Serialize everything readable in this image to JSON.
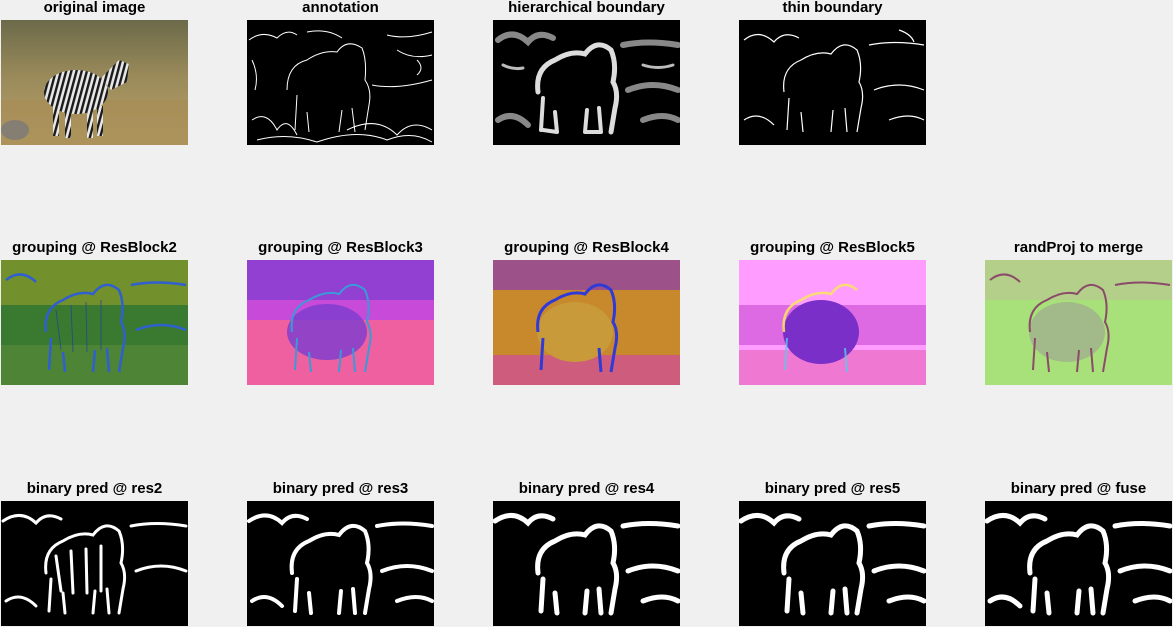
{
  "figure": {
    "rows": [
      {
        "panels": [
          {
            "title": "original image",
            "kind": "photo"
          },
          {
            "title": "annotation",
            "kind": "annotation"
          },
          {
            "title": "hierarchical boundary",
            "kind": "soft-boundary"
          },
          {
            "title": "thin boundary",
            "kind": "thin-boundary"
          }
        ]
      },
      {
        "panels": [
          {
            "title": "grouping @ ResBlock2",
            "kind": "grouping",
            "colors": [
              "#3a8a35",
              "#2f5fd0",
              "#9aa428"
            ]
          },
          {
            "title": "grouping @ ResBlock3",
            "kind": "grouping",
            "colors": [
              "#8a3cd6",
              "#ff6a8a",
              "#d24ad8"
            ]
          },
          {
            "title": "grouping @ ResBlock4",
            "kind": "grouping",
            "colors": [
              "#c88a2c",
              "#9a3ab0",
              "#2f4ad8"
            ]
          },
          {
            "title": "grouping @ ResBlock5",
            "kind": "grouping",
            "colors": [
              "#ff8cff",
              "#7a2fc8",
              "#e84ab0"
            ]
          },
          {
            "title": "randProj to merge",
            "kind": "grouping",
            "colors": [
              "#a8e07a",
              "#b08ab0",
              "#8c5a7a"
            ]
          }
        ]
      },
      {
        "panels": [
          {
            "title": "binary pred @ res2",
            "kind": "binary"
          },
          {
            "title": "binary pred @ res3",
            "kind": "binary"
          },
          {
            "title": "binary pred @ res4",
            "kind": "binary"
          },
          {
            "title": "binary pred @ res5",
            "kind": "binary"
          },
          {
            "title": "binary pred @ fuse",
            "kind": "binary"
          }
        ]
      }
    ]
  }
}
